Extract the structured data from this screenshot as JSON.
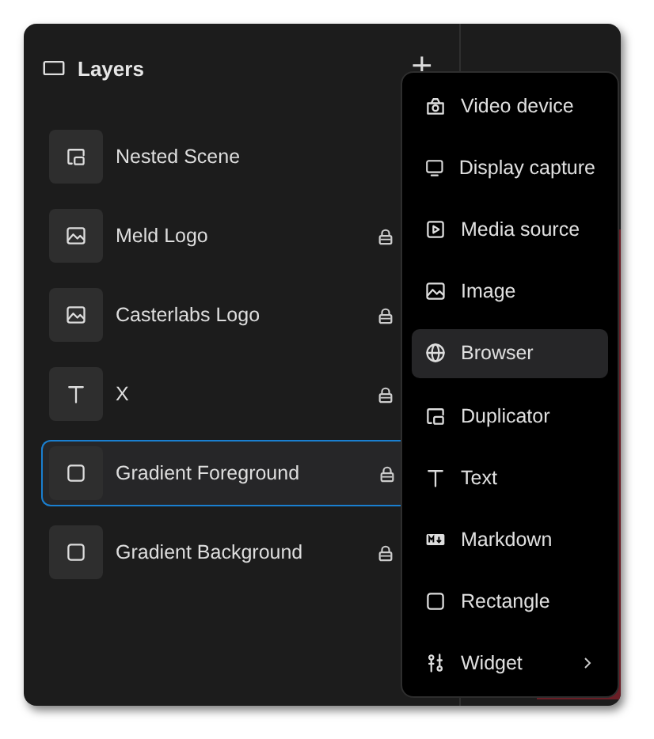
{
  "panel": {
    "title": "Layers",
    "add_button": "+"
  },
  "layers": [
    {
      "name": "Nested Scene",
      "kind": "scene",
      "locked": false,
      "selected": false
    },
    {
      "name": "Meld Logo",
      "kind": "image",
      "locked": true,
      "selected": false
    },
    {
      "name": "Casterlabs Logo",
      "kind": "image",
      "locked": true,
      "selected": false
    },
    {
      "name": "X",
      "kind": "text",
      "locked": true,
      "selected": false
    },
    {
      "name": "Gradient Foreground",
      "kind": "rect",
      "locked": true,
      "selected": true
    },
    {
      "name": "Gradient Background",
      "kind": "rect",
      "locked": true,
      "selected": false
    }
  ],
  "menu": [
    {
      "label": "Video device",
      "kind": "camera",
      "selected": false,
      "submenu": false
    },
    {
      "label": "Display capture",
      "kind": "monitor",
      "selected": false,
      "submenu": false
    },
    {
      "label": "Media source",
      "kind": "media",
      "selected": false,
      "submenu": false
    },
    {
      "label": "Image",
      "kind": "image",
      "selected": false,
      "submenu": false
    },
    {
      "label": "Browser",
      "kind": "globe",
      "selected": true,
      "submenu": false
    },
    {
      "label": "Duplicator",
      "kind": "scene",
      "selected": false,
      "submenu": false
    },
    {
      "label": "Text",
      "kind": "text",
      "selected": false,
      "submenu": false
    },
    {
      "label": "Markdown",
      "kind": "markdown",
      "selected": false,
      "submenu": false
    },
    {
      "label": "Rectangle",
      "kind": "rect",
      "selected": false,
      "submenu": false
    },
    {
      "label": "Widget",
      "kind": "widget",
      "selected": false,
      "submenu": true
    }
  ]
}
